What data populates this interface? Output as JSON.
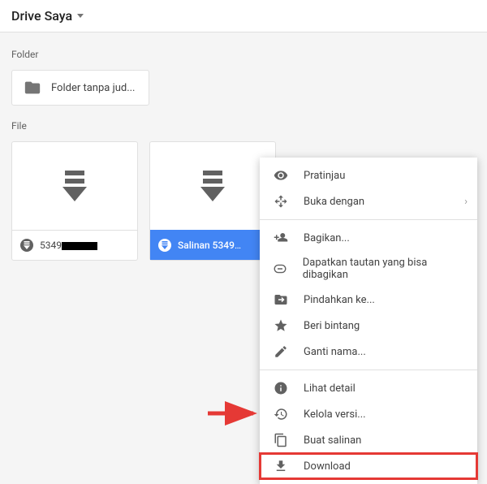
{
  "header": {
    "title": "Drive Saya"
  },
  "sections": {
    "folder_label": "Folder",
    "file_label": "File"
  },
  "folder": {
    "name": "Folder tanpa jud..."
  },
  "files": [
    {
      "name_prefix": "5349"
    },
    {
      "name_prefix": "Salinan 5349"
    }
  ],
  "icons": {
    "file_type": "stacked-download"
  },
  "context_menu": {
    "preview": "Pratinjau",
    "open_with": "Buka dengan",
    "share": "Bagikan...",
    "get_link": "Dapatkan tautan yang bisa dibagikan",
    "move_to": "Pindahkan ke...",
    "star": "Beri bintang",
    "rename": "Ganti nama...",
    "details": "Lihat detail",
    "versions": "Kelola versi...",
    "make_copy": "Buat salinan",
    "download": "Download"
  },
  "colors": {
    "selection": "#4285f4",
    "highlight_box": "#e53935"
  }
}
